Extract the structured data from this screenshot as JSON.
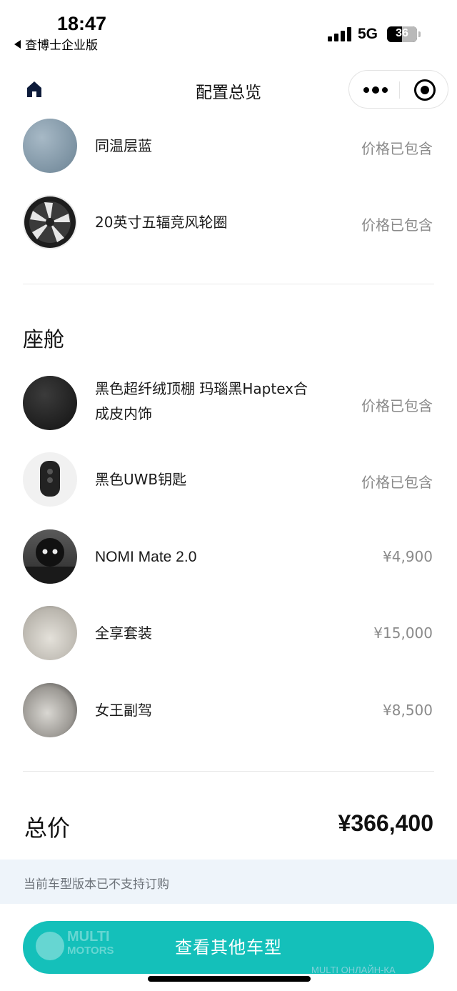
{
  "status_bar": {
    "time": "18:47",
    "back_app": "查博士企业版",
    "network": "5G",
    "battery": "36"
  },
  "nav": {
    "title": "配置总览",
    "home_icon": "home-icon",
    "more_icon": "more-dots-icon",
    "close_icon": "target-circle-icon"
  },
  "exterior_items": [
    {
      "name": "同温层蓝",
      "price": "价格已包含"
    },
    {
      "name": "20英寸五辐竞风轮圈",
      "price": "价格已包含"
    }
  ],
  "cabin": {
    "title": "座舱",
    "items": [
      {
        "name": "黑色超纤绒顶棚 玛瑙黑Haptex合成皮内饰",
        "price": "价格已包含"
      },
      {
        "name": "黑色UWB钥匙",
        "price": "价格已包含"
      },
      {
        "name": "NOMI Mate 2.0",
        "price": "¥4,900"
      },
      {
        "name": "全享套装",
        "price": "¥15,000"
      },
      {
        "name": "女王副驾",
        "price": "¥8,500"
      }
    ]
  },
  "total": {
    "label": "总价",
    "value": "¥366,400"
  },
  "notice": "当前车型版本已不支持订购",
  "cta": "查看其他车型",
  "watermark": {
    "line1": "MULTI",
    "line2": "MOTORS",
    "line3": "MULTI ОНЛАЙН-КА"
  },
  "colors": {
    "accent": "#14c0ba",
    "notice_bg": "#eef4fa",
    "price_gray": "#8a8a8a"
  }
}
